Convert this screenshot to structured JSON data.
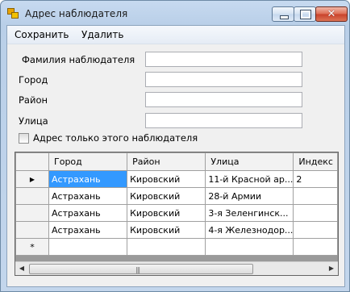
{
  "window": {
    "title": "Адрес наблюдателя",
    "close_glyph": "✕"
  },
  "menu": {
    "items": [
      "Сохранить",
      "Удалить"
    ]
  },
  "form": {
    "fields": [
      {
        "label": "Фамилия наблюдателя",
        "value": ""
      },
      {
        "label": "Город",
        "value": ""
      },
      {
        "label": "Район",
        "value": ""
      },
      {
        "label": "Улица",
        "value": ""
      }
    ],
    "checkbox_label": "Адрес только этого наблюдателя",
    "checkbox_checked": false
  },
  "grid": {
    "columns": [
      "Город",
      "Район",
      "Улица",
      "Индекс"
    ],
    "current_row_marker": "▶",
    "new_row_marker": "*",
    "rows": [
      [
        "Астрахань",
        "Кировский",
        "11-й Красной ар...",
        "2"
      ],
      [
        "Астрахань",
        "Кировский",
        "28-й Армии",
        ""
      ],
      [
        "Астрахань",
        "Кировский",
        "3-я Зеленгинск...",
        ""
      ],
      [
        "Астрахань",
        "Кировский",
        "4-я Железнодор...",
        ""
      ]
    ],
    "selected_row": 0,
    "selected_col": 0
  },
  "scrollbar": {
    "left_arrow": "◀",
    "right_arrow": "▶",
    "grip": "|||"
  }
}
